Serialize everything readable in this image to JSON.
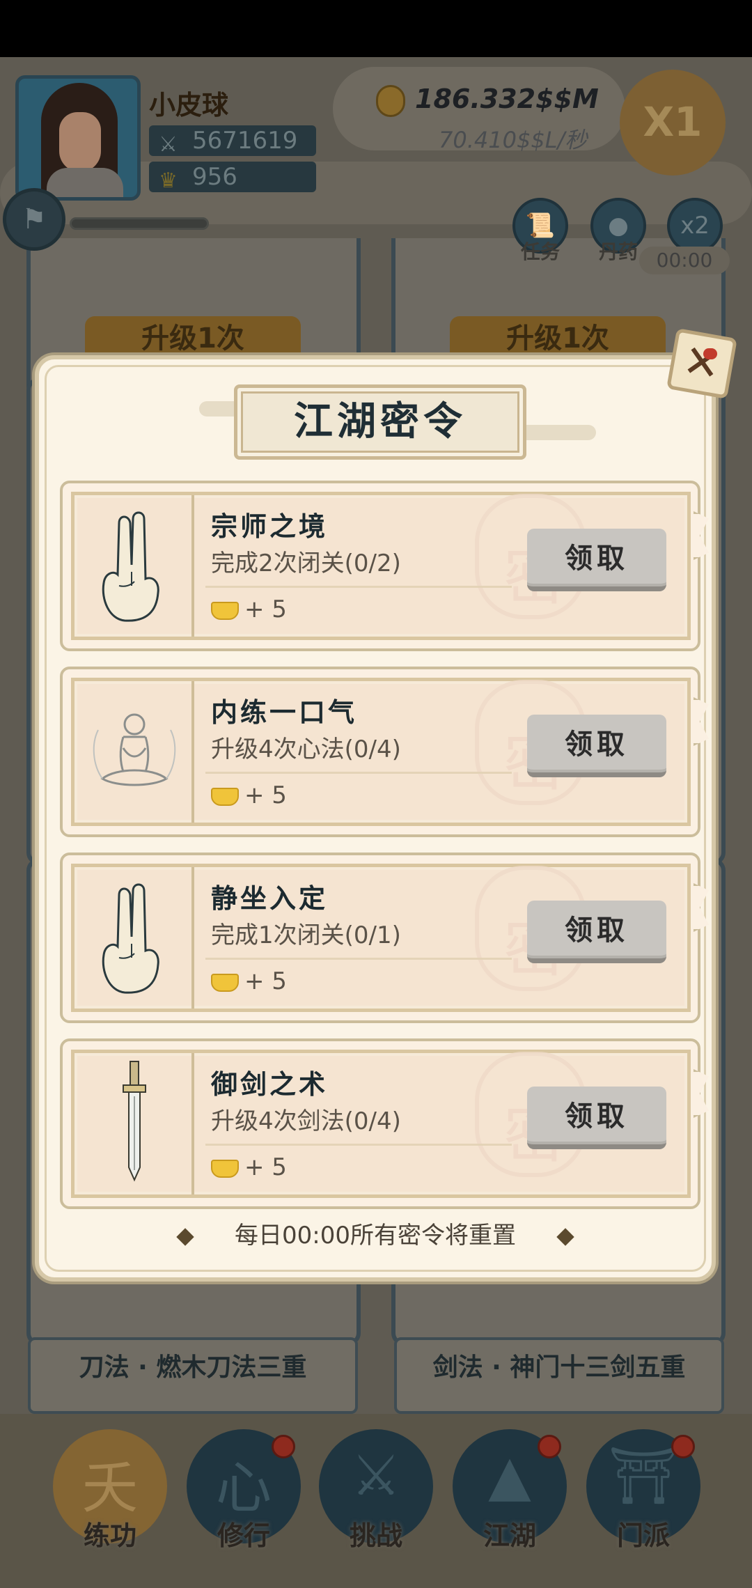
{
  "player": {
    "name": "小皮球",
    "power": "5671619",
    "yuanbao": "956"
  },
  "currency": {
    "coins": "186.332$$M",
    "rate": "70.410$$L/秒"
  },
  "speed_button": "X1",
  "quick_buttons": [
    {
      "label": "任务",
      "icon": "scroll-icon"
    },
    {
      "label": "丹药",
      "icon": "pill-icon"
    },
    {
      "label": "x2",
      "timer": "00:00"
    }
  ],
  "background": {
    "upgrade_label": "升级1次",
    "skill_left": "刀法 · 燃木刀法三重",
    "skill_right": "剑法 · 神门十三剑五重"
  },
  "dialog": {
    "title": "江湖密令",
    "close": "✕",
    "tasks": [
      {
        "name": "宗师之境",
        "desc": "完成2次闭关(0/2)",
        "reward": "+ 5",
        "button": "领取",
        "icon": "hand-seal-icon"
      },
      {
        "name": "内练一口气",
        "desc": "升级4次心法(0/4)",
        "reward": "+ 5",
        "button": "领取",
        "icon": "meditation-icon"
      },
      {
        "name": "静坐入定",
        "desc": "完成1次闭关(0/1)",
        "reward": "+ 5",
        "button": "领取",
        "icon": "hand-seal-icon"
      },
      {
        "name": "御剑之术",
        "desc": "升级4次剑法(0/4)",
        "reward": "+ 5",
        "button": "领取",
        "icon": "sword-icon"
      }
    ],
    "seal_char": "密",
    "reset_note": "每日00:00所有密令将重置"
  },
  "nav": [
    {
      "label": "练功",
      "icon": "martial-figure-icon",
      "badge": false
    },
    {
      "label": "修行",
      "icon": "heart-icon",
      "badge": true
    },
    {
      "label": "挑战",
      "icon": "crossed-swords-icon",
      "badge": false
    },
    {
      "label": "江湖",
      "icon": "mountain-icon",
      "badge": true
    },
    {
      "label": "门派",
      "icon": "gate-icon",
      "badge": true
    }
  ],
  "colors": {
    "dialog_bg": "#fbf4e6",
    "task_bg": "#f5e4d1",
    "title_ink": "#1f2e35",
    "claim_button": "#c8c5c0",
    "nav_badge": "#8e2a1e"
  }
}
